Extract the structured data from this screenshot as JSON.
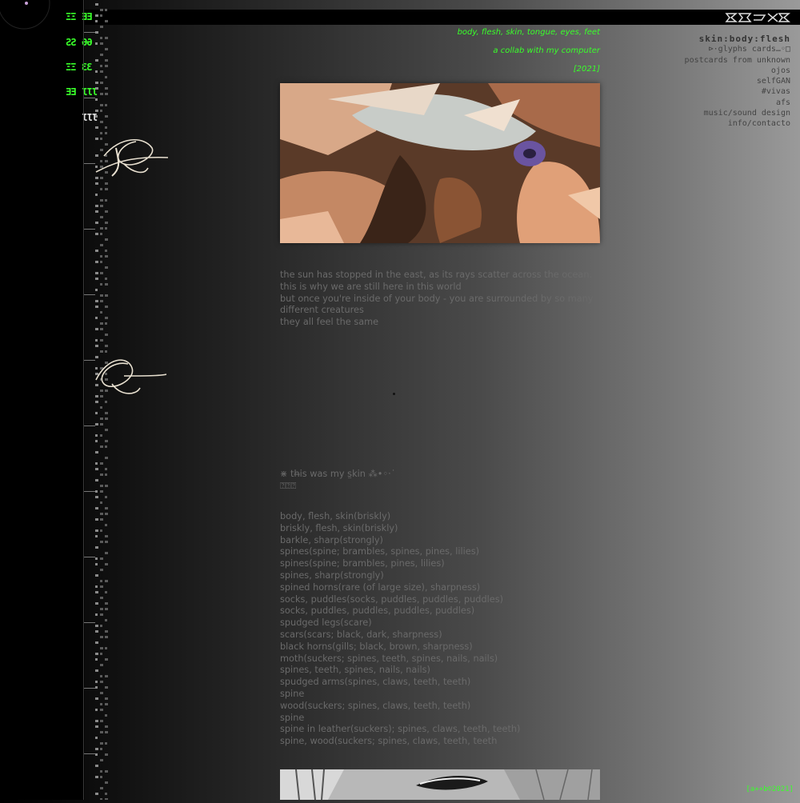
{
  "header": {
    "subtitle_1": "body, flesh, skin, tongue, eyes, feet",
    "subtitle_2": "a collab with my computer",
    "year": "[2021]"
  },
  "brand": {
    "logo_icon": "glitch-logo-icon"
  },
  "glyph_nav": [
    {
      "label": "ΞΞ"
    },
    {
      "label": "ƎƎ"
    },
    {
      "label": "ƧƧ"
    },
    {
      "label": "ƏƏ"
    },
    {
      "label": "ΞΞ"
    },
    {
      "label": "ƐƐ"
    },
    {
      "label": "ƎƎ"
    },
    {
      "label": "ƖƖƖ"
    },
    {
      "label": "ƖƖƖ"
    }
  ],
  "nav": {
    "title": "skin:body:flesh",
    "items": [
      {
        "label": "⊳·glyphs cards…◦□"
      },
      {
        "label": "postcards from unknown"
      },
      {
        "label": "ojos"
      },
      {
        "label": "selfGAN"
      },
      {
        "label": "#vivas"
      },
      {
        "label": "afs"
      },
      {
        "label": "music/sound design"
      },
      {
        "label": "info/contacto"
      }
    ]
  },
  "intro": [
    "the sun has stopped in the east, as its rays scatter across the ocean.",
    "this is why we are still here in this world",
    "but once you're inside of your body - you are surrounded by so many",
    "different creatures",
    "they all feel the same"
  ],
  "skin_note": {
    "line1": "⋇ th̶is was my s̤kin ⁂•◦·˙",
    "line2": "⍰⍰⍰"
  },
  "list": [
    "body, flesh, skin(briskly)",
    "briskly, flesh, skin(briskly)",
    "barkle, sharp(strongly)",
    "spines(spine; brambles, spines, pines, lilies)",
    "spines(spine; brambles, pines, lilies)",
    "spines, sharp(strongly)",
    "spined horns(rare (of large size), sharpness)",
    "socks, puddles(socks, puddles, puddles, puddles)",
    "socks, puddles, puddles, puddles, puddles)",
    "spudged legs(scare)",
    "scars(scars; black, dark, sharpness)",
    "black horns(gills; black, brown, sharpness)",
    "moth(suckers; spines, teeth, spines, nails, nails)",
    "spines, teeth, spines, nails, nails)",
    "spudged arms(spines, claws, teeth, teeth)",
    "spine",
    "wood(suckers; spines, claws, teeth, teeth)",
    "spine",
    "spine in leather(suckers); spines, claws, teeth, teeth)",
    "spine, wood(suckers; spines, claws, teeth, teeth"
  ],
  "footer": {
    "copyright": "[a++b©2021]"
  },
  "colors": {
    "accent": "#39ff2a",
    "text": "#6a6a6a",
    "nav": "#444444"
  }
}
